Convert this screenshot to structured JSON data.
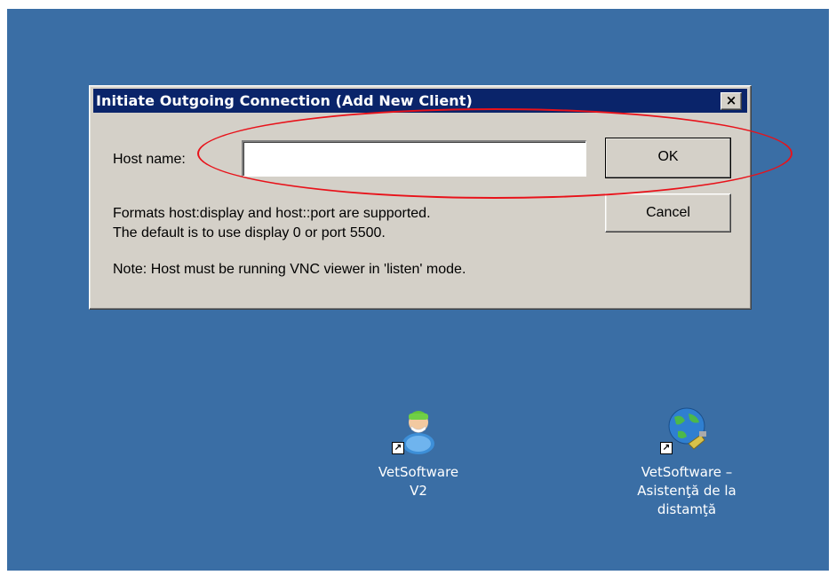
{
  "dialog": {
    "title": "Initiate Outgoing Connection (Add New Client)",
    "close_glyph": "×",
    "host_label": "Host name:",
    "host_value": "",
    "ok_label": "OK",
    "cancel_label": "Cancel",
    "formats_line1": "Formats host:display and host::port are supported.",
    "formats_line2": "The default is to use display 0 or port 5500.",
    "note": "Note: Host must be running VNC viewer in 'listen' mode."
  },
  "desktop": {
    "background_color": "#3a6ea5",
    "icons": [
      {
        "caption_lines": [
          "VetSoftware",
          "V2"
        ],
        "icon": "doctor-user-icon"
      },
      {
        "caption_lines": [
          "VetSoftware –",
          "Asistenţă de la",
          "distamţă"
        ],
        "icon": "globe-plug-icon"
      }
    ]
  },
  "annotation": {
    "color": "#e8121a",
    "shape": "ellipse"
  }
}
